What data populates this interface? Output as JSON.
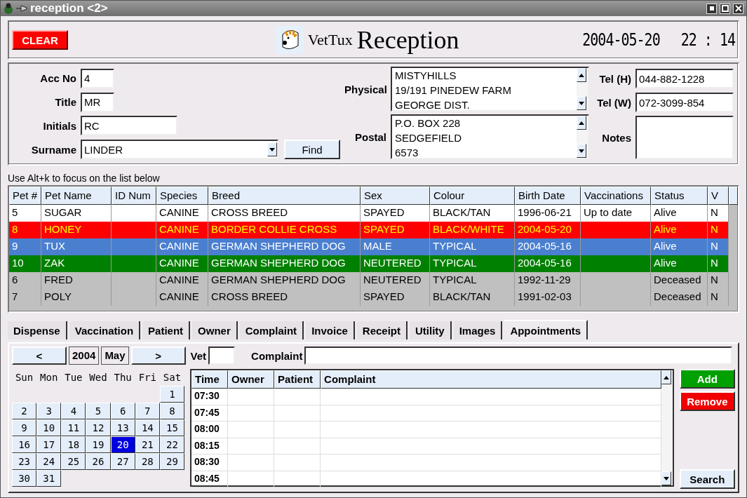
{
  "window": {
    "title": "reception <2>"
  },
  "header": {
    "clear_button": {
      "label": "CLEAR"
    },
    "logo_small": "VetTux",
    "logo_large": "Reception",
    "date": "2004-05-20",
    "time": "22 : 14"
  },
  "owner": {
    "fields": [
      {
        "label": "Acc No",
        "value": "4",
        "kind": "short"
      },
      {
        "label": "Title",
        "value": "MR",
        "kind": "short"
      },
      {
        "label": "Initials",
        "value": "RC",
        "kind": "medium"
      },
      {
        "label": "Surname",
        "value": "LINDER",
        "kind": "combo"
      }
    ],
    "find_button": {
      "label": "Find"
    },
    "addresses": [
      {
        "label": "Physical",
        "lines": [
          "MISTYHILLS",
          "19/191 PINEDEW FARM",
          "GEORGE DIST."
        ]
      },
      {
        "label": "Postal",
        "lines": [
          "P.O. BOX 228",
          "SEDGEFIELD",
          "6573"
        ]
      }
    ],
    "phones": [
      {
        "label": "Tel (H)",
        "value": "044-882-1228",
        "kind": "line"
      },
      {
        "label": "Tel (W)",
        "value": "072-3099-854",
        "kind": "line"
      },
      {
        "label": "Notes",
        "kind": "area"
      }
    ]
  },
  "hint": {
    "text": "Use Alt+k to focus on the list below"
  },
  "pets": {
    "columns": [
      "Pet #",
      "Pet Name",
      "ID Num",
      "Species",
      "Breed",
      "Sex",
      "Colour",
      "Birth Date",
      "Vaccinations",
      "Status",
      "V"
    ],
    "rows": [
      {
        "cells": [
          "5",
          "SUGAR",
          "",
          "CANINE",
          "CROSS BREED",
          "SPAYED",
          "BLACK/TAN",
          "1996-06-21",
          "Up to date",
          "Alive",
          "N"
        ],
        "color": "#ffffff",
        "kind": "light"
      },
      {
        "cells": [
          "8",
          "HONEY",
          "",
          "CANINE",
          "BORDER COLLIE CROSS",
          "SPAYED",
          "BLACK/WHITE",
          "2004-05-20",
          "",
          "Alive",
          "N"
        ],
        "color": "#ff0000",
        "kind": "alert"
      },
      {
        "cells": [
          "9",
          "TUX",
          "",
          "CANINE",
          "GERMAN SHEPHERD DOG",
          "MALE",
          "TYPICAL",
          "2004-05-16",
          "",
          "Alive",
          "N"
        ],
        "color": "#4a7fd0",
        "kind": "dark"
      },
      {
        "cells": [
          "10",
          "ZAK",
          "",
          "CANINE",
          "GERMAN SHEPHERD DOG",
          "NEUTERED",
          "TYPICAL",
          "2004-05-16",
          "",
          "Alive",
          "N"
        ],
        "color": "#008000",
        "kind": "dark"
      },
      {
        "cells": [
          "6",
          "FRED",
          "",
          "CANINE",
          "GERMAN SHEPHERD DOG",
          "NEUTERED",
          "TYPICAL",
          "1992-11-29",
          "",
          "Deceased",
          "N"
        ],
        "color": "#c0c0c0",
        "kind": "light"
      },
      {
        "cells": [
          "7",
          "POLY",
          "",
          "CANINE",
          "CROSS BREED",
          "SPAYED",
          "BLACK/TAN",
          "1991-02-03",
          "",
          "Deceased",
          "N"
        ],
        "color": "#c0c0c0",
        "kind": "light"
      }
    ]
  },
  "tabs": [
    {
      "label": "Dispense",
      "selected": false
    },
    {
      "label": "Vaccination",
      "selected": false
    },
    {
      "label": "Patient",
      "selected": false
    },
    {
      "label": "Owner",
      "selected": false
    },
    {
      "label": "Complaint",
      "selected": false
    },
    {
      "label": "Invoice",
      "selected": false
    },
    {
      "label": "Receipt",
      "selected": false
    },
    {
      "label": "Utility",
      "selected": false
    },
    {
      "label": "Images",
      "selected": false
    },
    {
      "label": "Appointments",
      "selected": true
    }
  ],
  "appointments": {
    "prev": "<",
    "year": "2004",
    "month": "May",
    "next": ">",
    "vet_label": "Vet",
    "complaint_label": "Complaint",
    "weekdays": [
      "Sun",
      "Mon",
      "Tue",
      "Wed",
      "Thu",
      "Fri",
      "Sat"
    ],
    "weeks": [
      [
        {
          "kind": "blank"
        },
        {
          "kind": "blank"
        },
        {
          "kind": "blank"
        },
        {
          "kind": "blank"
        },
        {
          "kind": "blank"
        },
        {
          "kind": "blank"
        },
        {
          "kind": "day",
          "label": "1",
          "selected": false
        }
      ],
      [
        {
          "label": "2",
          "selected": false
        },
        {
          "label": "3",
          "selected": false
        },
        {
          "label": "4",
          "selected": false
        },
        {
          "label": "5",
          "selected": false
        },
        {
          "label": "6",
          "selected": false
        },
        {
          "label": "7",
          "selected": false
        },
        {
          "label": "8",
          "selected": false
        }
      ],
      [
        {
          "label": "9",
          "selected": false
        },
        {
          "label": "10",
          "selected": false
        },
        {
          "label": "11",
          "selected": false
        },
        {
          "label": "12",
          "selected": false
        },
        {
          "label": "13",
          "selected": false
        },
        {
          "label": "14",
          "selected": false
        },
        {
          "label": "15",
          "selected": false
        }
      ],
      [
        {
          "label": "16",
          "selected": false
        },
        {
          "label": "17",
          "selected": false
        },
        {
          "label": "18",
          "selected": false
        },
        {
          "label": "19",
          "selected": false
        },
        {
          "label": "20",
          "selected": true
        },
        {
          "label": "21",
          "selected": false
        },
        {
          "label": "22",
          "selected": false
        }
      ],
      [
        {
          "label": "23",
          "selected": false
        },
        {
          "label": "24",
          "selected": false
        },
        {
          "label": "25",
          "selected": false
        },
        {
          "label": "26",
          "selected": false
        },
        {
          "label": "27",
          "selected": false
        },
        {
          "label": "28",
          "selected": false
        },
        {
          "label": "29",
          "selected": false
        }
      ],
      [
        {
          "label": "30",
          "selected": false
        },
        {
          "label": "31",
          "selected": false
        }
      ]
    ],
    "columns": [
      "Time",
      "Owner",
      "Patient",
      "Complaint"
    ],
    "slots": [
      "07:30",
      "07:45",
      "08:00",
      "08:15",
      "08:30",
      "08:45"
    ],
    "buttons": [
      {
        "label": "Add",
        "kind": "add"
      },
      {
        "label": "Remove",
        "kind": "remove"
      },
      {
        "label": "Search",
        "kind": "plain"
      }
    ]
  }
}
